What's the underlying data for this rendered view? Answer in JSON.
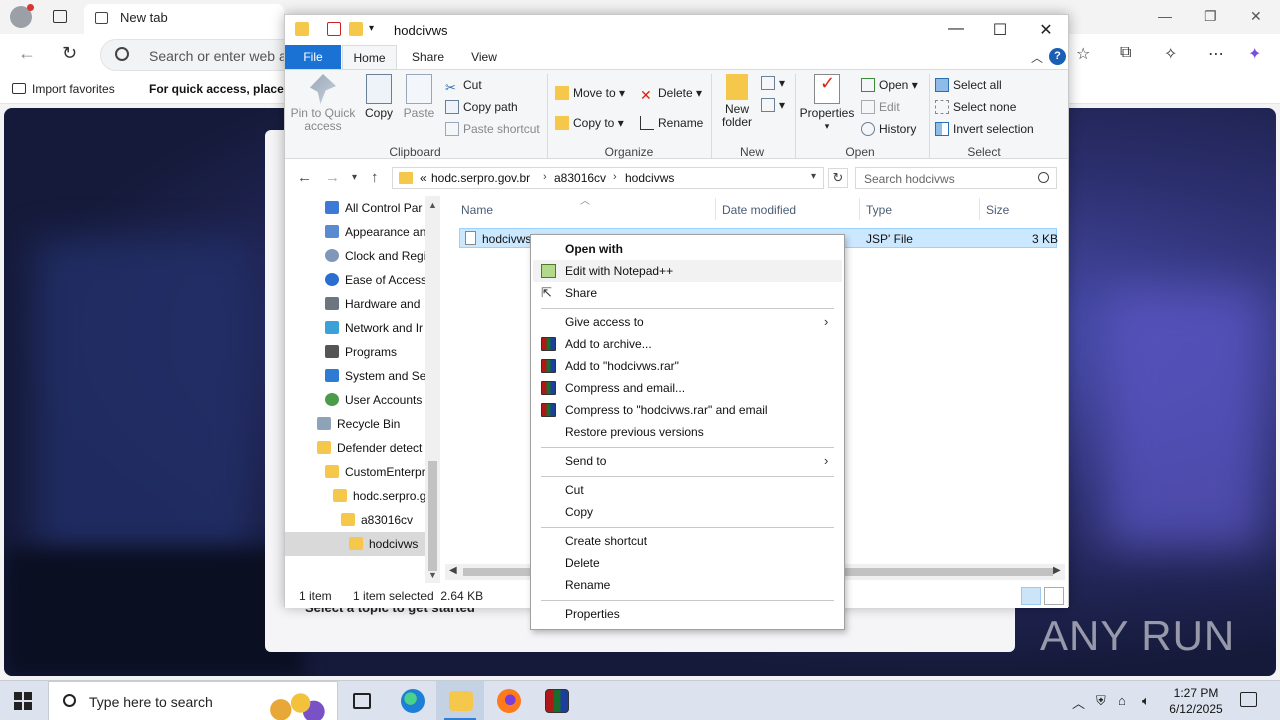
{
  "browser": {
    "tab_label": "New tab",
    "address_placeholder": "Search or enter web a",
    "fav_import": "Import favorites",
    "fav_hint": "For quick access, place y",
    "card_topic": "Select a topic to get started",
    "watermark": "ANY RUN"
  },
  "explorer": {
    "title": "hodcivws",
    "tabs": {
      "file": "File",
      "home": "Home",
      "share": "Share",
      "view": "View"
    },
    "ribbon": {
      "pin": "Pin to Quick access",
      "copy": "Copy",
      "paste": "Paste",
      "cut": "Cut",
      "copy_path": "Copy path",
      "paste_shortcut": "Paste shortcut",
      "clipboard_group": "Clipboard",
      "move_to": "Move to",
      "copy_to": "Copy to",
      "delete": "Delete",
      "rename": "Rename",
      "organize_group": "Organize",
      "new_folder": "New folder",
      "new_group": "New",
      "properties": "Properties",
      "open": "Open",
      "edit": "Edit",
      "history": "History",
      "open_group": "Open",
      "select_all": "Select all",
      "select_none": "Select none",
      "invert_selection": "Invert selection",
      "select_group": "Select"
    },
    "address": {
      "prefix": "«",
      "crumb1": "hodc.serpro.gov.br",
      "crumb2": "a83016cv",
      "crumb3": "hodcivws"
    },
    "search_placeholder": "Search hodcivws",
    "nav": [
      "All Control Par",
      "Appearance an",
      "Clock and Regi",
      "Ease of Access",
      "Hardware and",
      "Network and Ir",
      "Programs",
      "System and Se",
      "User Accounts",
      "Recycle Bin",
      "Defender detect",
      "CustomEnterpr",
      "hodc.serpro.g",
      "a83016cv",
      "hodcivws"
    ],
    "columns": {
      "name": "Name",
      "date": "Date modified",
      "type": "Type",
      "size": "Size"
    },
    "file": {
      "name": "hodcivws",
      "type": "JSP' File",
      "size": "3 KB"
    },
    "status": {
      "count": "1 item",
      "selected": "1 item selected  2.64 KB"
    }
  },
  "context_menu": {
    "open_with": "Open with",
    "edit_notepad": "Edit with Notepad++",
    "share": "Share",
    "give_access": "Give access to",
    "add_archive": "Add to archive...",
    "add_rar": "Add to \"hodcivws.rar\"",
    "compress_email": "Compress and email...",
    "compress_rar_email": "Compress to \"hodcivws.rar\" and email",
    "restore": "Restore previous versions",
    "send_to": "Send to",
    "cut": "Cut",
    "copy": "Copy",
    "create_shortcut": "Create shortcut",
    "delete": "Delete",
    "rename": "Rename",
    "properties": "Properties"
  },
  "taskbar": {
    "search": "Type here to search",
    "time": "1:27 PM",
    "date": "6/12/2025"
  }
}
